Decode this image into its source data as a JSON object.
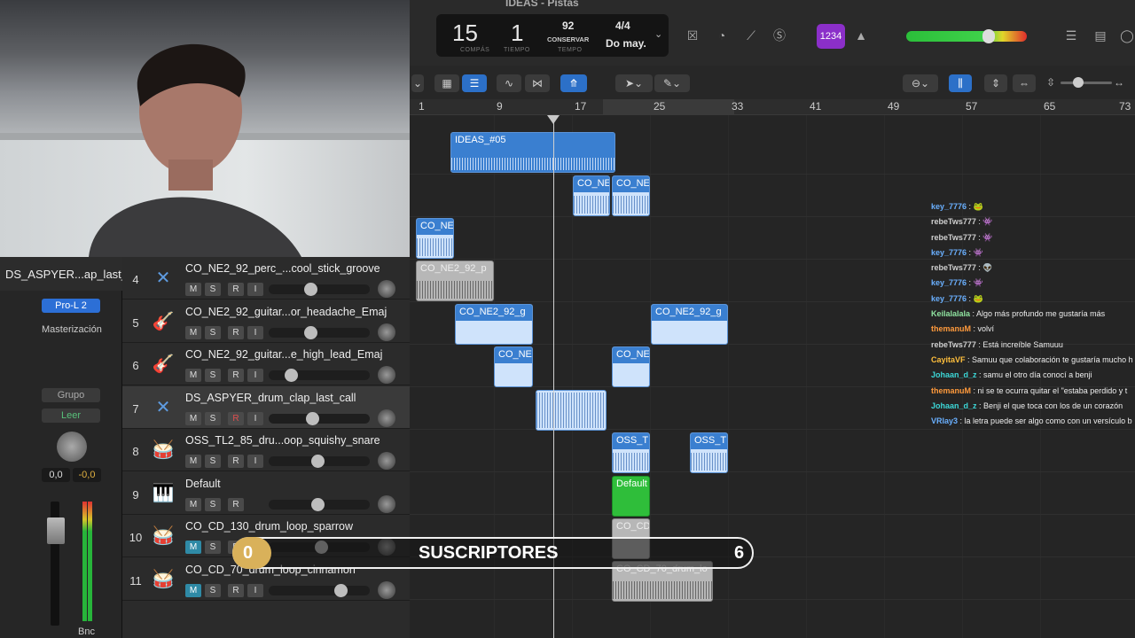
{
  "window": {
    "title": "IDEAS - Pistas"
  },
  "lcd": {
    "bars": "15",
    "beat": "1",
    "bars_label": "COMPÁS",
    "beat_label": "TIEMPO",
    "tempo": "92",
    "tempo_mode": "CONSERVAR",
    "tempo_label": "TEMPO",
    "signature": "4/4",
    "key": "Do may."
  },
  "toolbar": {
    "count_in_label": "1234"
  },
  "ruler": {
    "marks": [
      "1",
      "9",
      "17",
      "25",
      "33",
      "41",
      "49",
      "57",
      "65",
      "73"
    ]
  },
  "inspector": {
    "track_name": "DS_ASPYER...ap_last_call",
    "plugin": "Pro-L 2",
    "mastering_label": "Masterización",
    "group_label": "Grupo",
    "read_label": "Leer",
    "vol_value": "0,0",
    "peak_value": "-0,0",
    "bounce_label": "Bnc"
  },
  "tracks": [
    {
      "num": "4",
      "name": "CO_NE2_92_perc_...cool_stick_groove",
      "icon": "x-icon",
      "m": "M",
      "s": "S",
      "r": "R",
      "i": "I"
    },
    {
      "num": "5",
      "name": "CO_NE2_92_guitar...or_headache_Emaj",
      "icon": "guitar-icon",
      "m": "M",
      "s": "S",
      "r": "R",
      "i": "I"
    },
    {
      "num": "6",
      "name": "CO_NE2_92_guitar...e_high_lead_Emaj",
      "icon": "guitar-icon",
      "m": "M",
      "s": "S",
      "r": "R",
      "i": "I"
    },
    {
      "num": "7",
      "name": "DS_ASPYER_drum_clap_last_call",
      "icon": "x-icon",
      "m": "M",
      "s": "S",
      "r": "R",
      "i": "I"
    },
    {
      "num": "8",
      "name": "OSS_TL2_85_dru...oop_squishy_snare",
      "icon": "drum-icon",
      "m": "M",
      "s": "S",
      "r": "R",
      "i": "I"
    },
    {
      "num": "9",
      "name": "Default",
      "icon": "keyboard-icon",
      "m": "M",
      "s": "S",
      "r": "R",
      "i": ""
    },
    {
      "num": "10",
      "name": "CO_CD_130_drum_loop_sparrow",
      "icon": "drumkit-icon",
      "m": "M",
      "s": "S",
      "r": "R",
      "i": "I"
    },
    {
      "num": "11",
      "name": "CO_CD_70_drum_loop_cinnamon",
      "icon": "drumkit-icon",
      "m": "M",
      "s": "S",
      "r": "R",
      "i": "I"
    }
  ],
  "regions": [
    {
      "label": "IDEAS_#05",
      "color": "blue"
    },
    {
      "label": "CO_NE",
      "color": "blue"
    },
    {
      "label": "CO_NE",
      "color": "blue"
    },
    {
      "label": "CO_NE",
      "color": "blue"
    },
    {
      "label": "CO_NE2_92_p",
      "color": "gray"
    },
    {
      "label": "CO_NE2_92_g",
      "color": "blue"
    },
    {
      "label": "CO_NE2_92_g",
      "color": "blue"
    },
    {
      "label": "CO_NE",
      "color": "blue"
    },
    {
      "label": "CO_NE",
      "color": "blue"
    },
    {
      "label": "OSS_T",
      "color": "blue"
    },
    {
      "label": "OSS_T",
      "color": "blue"
    },
    {
      "label": "Default",
      "color": "green"
    },
    {
      "label": "CO_CD",
      "color": "gray"
    },
    {
      "label": "CO_CD_70_drum_lo",
      "color": "gray"
    }
  ],
  "chat": [
    {
      "user": "key_7776",
      "text": "🐸",
      "color": "#6ab0ff"
    },
    {
      "user": "rebeTws777",
      "text": "👾",
      "color": "#cfcfcf"
    },
    {
      "user": "rebeTws777",
      "text": "👾",
      "color": "#cfcfcf"
    },
    {
      "user": "key_7776",
      "text": "👾",
      "color": "#6ab0ff"
    },
    {
      "user": "rebeTws777",
      "text": "👽",
      "color": "#cfcfcf"
    },
    {
      "user": "key_7776",
      "text": "👾",
      "color": "#6ab0ff"
    },
    {
      "user": "key_7776",
      "text": "🐸",
      "color": "#6ab0ff"
    },
    {
      "user": "Keilalalala",
      "text": "Algo más profundo me gustaría más",
      "color": "#8fe3a0"
    },
    {
      "user": "themanuM",
      "text": "volví",
      "color": "#ff9a3c"
    },
    {
      "user": "rebeTws777",
      "text": "Está increíble Samuuu",
      "color": "#cfcfcf"
    },
    {
      "user": "CayitaVF",
      "text": "Samuu que colaboración te gustaría mucho h",
      "color": "#ffbf3c"
    },
    {
      "user": "Johaan_d_z",
      "text": "samu el otro día conocí a benji",
      "color": "#3cd6d6"
    },
    {
      "user": "themanuM",
      "text": "ni se te ocurra quitar el \"estaba perdido y t",
      "color": "#ff9a3c"
    },
    {
      "user": "Johaan_d_z",
      "text": "Benji el que toca con los de un corazón",
      "color": "#3cd6d6"
    },
    {
      "user": "VRlay3",
      "text": "la letra puede ser algo como con un versículo b",
      "color": "#6ab0ff"
    }
  ],
  "subscribers": {
    "current": "0",
    "label": "SUSCRIPTORES",
    "goal": "6",
    "fill_fraction": 0
  },
  "colors": {
    "region_blue": "#3a7fd0",
    "region_green": "#2fbe3a",
    "accent_purple": "#8b2fc9",
    "mute_teal": "#2f8aa6"
  }
}
